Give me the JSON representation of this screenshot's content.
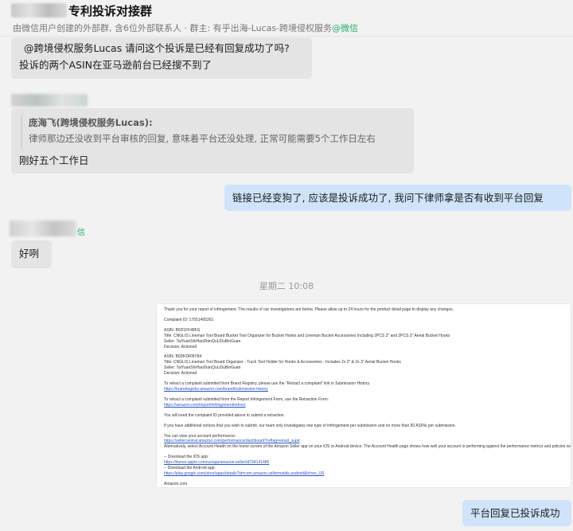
{
  "header": {
    "title": "专利投诉对接群",
    "subtitle": "由微信用户创建的外部群, 含6位外部联系人 · 群主: 有乎出海-Lucas-跨境侵权服务",
    "subtitle_suffix": "@微信"
  },
  "messages": {
    "m1_line1": "@跨境侵权服务Lucas  请问这个投诉是已经有回复成功了吗?",
    "m1_line2": "投诉的两个ASIN在亚马逊前台已经搜不到了",
    "m2_quote_name": "庞海飞(跨境侵权服务Lucas):",
    "m2_quote_text": "律师那边还没收到平台审核的回复, 意味着平台还没处理, 正常可能需要5个工作日左右",
    "m2_text": "刚好五个工作日",
    "m3_text": "链接已经变狗了, 应该是投诉成功了, 我问下律师拿是否有收到平台回复",
    "m4_text": "好咧",
    "timestamp": "星期二 10:08",
    "m6_text": "平台回复已投诉成功",
    "green_mark": "信"
  },
  "document": {
    "lines": [
      "Thank you for your report of infringement. The results of our investigations are below. Please allow up to 24 hours for the product detail page to display any changes.",
      "",
      "Complaint ID: 17551465361",
      "",
      "ASIN: B0D1FF48FG",
      "Title: CNGLIS Lineman Tool Board Bucket Tool Organizer for Bucket Hooks and Lineman Bucket Accessories Including 2PCS 3\" and 2PCS 3\" Aerial Bucket Hooks",
      "Seller: TaiYuanShiHaoDianQuLiDuBinGuan",
      "Decision: Actioned",
      "",
      "ASIN: B0DKDRNY84",
      "Title: CNGLIS Lineman Tool Board Organizer - Truck Tool Holder for Hooks & Accessories - Includes 2x 2\" & 2x 3\" Aerial Bucket Hooks",
      "Seller: TaiYuanShiHaoDianQuLiDuBinGuan",
      "Decision: Actioned",
      "",
      "To retract a complaint submitted from Brand Registry, please use the \"Retract a complaint\" link in Submission History.",
      "https://brandregistry.amazon.com/brand/submission-history",
      "",
      "To retract a complaint submitted from the Report Infringement Form, use the Retraction Form:",
      "https://amazon.com/report/infringement/retract",
      "",
      "You will need the complaint ID provided above to submit a retraction.",
      "",
      "If you have additional notices that you wish to submit, our team only investigates one type of infringement per submission and no more than 50 ASINs per submission.",
      "",
      "You can view your account performance:",
      "https://sellercentral.amazon.com/performance/dashboard?reftag=email_sapd",
      "Alternatively, select Account Health on the home screen of the Amazon Seller app on your iOS or Android device. The Account Health page shows how well your account is performing against the performance metrics and policies required to sell on Amazon.",
      "",
      "-- Download the iOS app:",
      "https://itunes.apple.com/us/app/amazon-seller/id794141485",
      "-- Download the Android app:",
      "https://play.google.com/store/apps/details?id=com.amazon.sellermobile.android&hl=en_US",
      "",
      "Amazon.com"
    ]
  }
}
